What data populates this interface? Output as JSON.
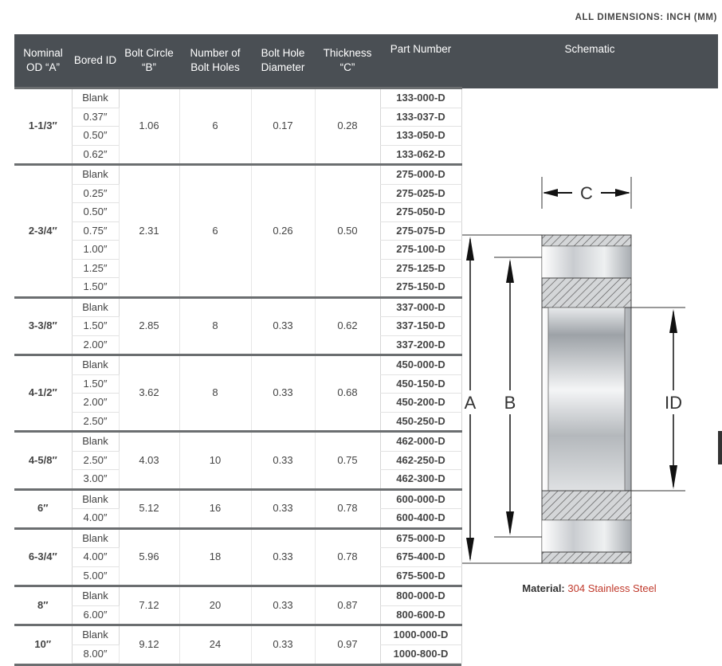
{
  "dimensions_note": "ALL DIMENSIONS: INCH (MM)",
  "headers": {
    "nominal": "Nominal OD “A”",
    "bored": "Bored ID",
    "bolt_circle": "Bolt Circle “B”",
    "num_holes": "Number of Bolt Holes",
    "hole_dia": "Bolt Hole Diameter",
    "thickness": "Thickness “C”",
    "part": "Part Number",
    "schematic": "Schematic"
  },
  "groups": [
    {
      "od": "1-1/3″",
      "bolt_circle": "1.06",
      "holes": "6",
      "hole_dia": "0.17",
      "thickness": "0.28",
      "rows": [
        {
          "id": "Blank",
          "part": "133-000-D"
        },
        {
          "id": "0.37″",
          "part": "133-037-D"
        },
        {
          "id": "0.50″",
          "part": "133-050-D"
        },
        {
          "id": "0.62″",
          "part": "133-062-D"
        }
      ]
    },
    {
      "od": "2-3/4″",
      "bolt_circle": "2.31",
      "holes": "6",
      "hole_dia": "0.26",
      "thickness": "0.50",
      "rows": [
        {
          "id": "Blank",
          "part": "275-000-D"
        },
        {
          "id": "0.25″",
          "part": "275-025-D"
        },
        {
          "id": "0.50″",
          "part": "275-050-D"
        },
        {
          "id": "0.75″",
          "part": "275-075-D"
        },
        {
          "id": "1.00″",
          "part": "275-100-D"
        },
        {
          "id": "1.25″",
          "part": "275-125-D"
        },
        {
          "id": "1.50″",
          "part": "275-150-D"
        }
      ]
    },
    {
      "od": "3-3/8″",
      "bolt_circle": "2.85",
      "holes": "8",
      "hole_dia": "0.33",
      "thickness": "0.62",
      "rows": [
        {
          "id": "Blank",
          "part": "337-000-D"
        },
        {
          "id": "1.50″",
          "part": "337-150-D"
        },
        {
          "id": "2.00″",
          "part": "337-200-D"
        }
      ]
    },
    {
      "od": "4-1/2″",
      "bolt_circle": "3.62",
      "holes": "8",
      "hole_dia": "0.33",
      "thickness": "0.68",
      "rows": [
        {
          "id": "Blank",
          "part": "450-000-D"
        },
        {
          "id": "1.50″",
          "part": "450-150-D"
        },
        {
          "id": "2.00″",
          "part": "450-200-D"
        },
        {
          "id": "2.50″",
          "part": "450-250-D"
        }
      ]
    },
    {
      "od": "4-5/8″",
      "bolt_circle": "4.03",
      "holes": "10",
      "hole_dia": "0.33",
      "thickness": "0.75",
      "rows": [
        {
          "id": "Blank",
          "part": "462-000-D"
        },
        {
          "id": "2.50″",
          "part": "462-250-D"
        },
        {
          "id": "3.00″",
          "part": "462-300-D"
        }
      ]
    },
    {
      "od": "6″",
      "bolt_circle": "5.12",
      "holes": "16",
      "hole_dia": "0.33",
      "thickness": "0.78",
      "rows": [
        {
          "id": "Blank",
          "part": "600-000-D"
        },
        {
          "id": "4.00″",
          "part": "600-400-D"
        }
      ]
    },
    {
      "od": "6-3/4″",
      "bolt_circle": "5.96",
      "holes": "18",
      "hole_dia": "0.33",
      "thickness": "0.78",
      "rows": [
        {
          "id": "Blank",
          "part": "675-000-D"
        },
        {
          "id": "4.00″",
          "part": "675-400-D"
        },
        {
          "id": "5.00″",
          "part": "675-500-D"
        }
      ]
    },
    {
      "od": "8″",
      "bolt_circle": "7.12",
      "holes": "20",
      "hole_dia": "0.33",
      "thickness": "0.87",
      "rows": [
        {
          "id": "Blank",
          "part": "800-000-D"
        },
        {
          "id": "6.00″",
          "part": "800-600-D"
        }
      ]
    },
    {
      "od": "10″",
      "bolt_circle": "9.12",
      "holes": "24",
      "hole_dia": "0.33",
      "thickness": "0.97",
      "rows": [
        {
          "id": "Blank",
          "part": "1000-000-D"
        },
        {
          "id": "8.00″",
          "part": "1000-800-D"
        }
      ]
    }
  ],
  "schematic": {
    "label_a": "A",
    "label_b": "B",
    "label_c": "C",
    "label_id": "ID",
    "material_label": "Material:",
    "material_value": "304 Stainless Steel"
  },
  "colors": {
    "header_bg": "#4a4f54",
    "material_value": "#c0392b"
  }
}
